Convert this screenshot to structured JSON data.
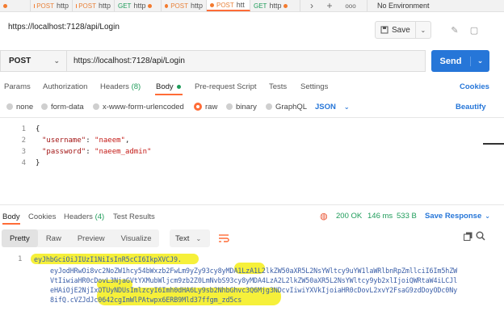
{
  "tabs": [
    {
      "method": "POST",
      "title": "http",
      "dirty": true
    },
    {
      "method": "POST",
      "title": "http",
      "dirty": true
    },
    {
      "method": "GET",
      "title": "http",
      "dirty": true
    },
    {
      "method": "POST",
      "title": "http",
      "dirty": true
    },
    {
      "method": "POST",
      "title": "htt",
      "dirty": true,
      "active": true
    },
    {
      "method": "GET",
      "title": "http",
      "dirty": true
    }
  ],
  "tabbar": {
    "new_tab": "+",
    "more": "ooo"
  },
  "environment": "No Environment",
  "request": {
    "title": "https://localhost:7128/api/Login",
    "save_label": "Save",
    "method": "POST",
    "url": "https://localhost:7128/api/Login",
    "send_label": "Send"
  },
  "request_tabs": {
    "params": "Params",
    "authorization": "Authorization",
    "headers": "Headers",
    "headers_count": "(8)",
    "body": "Body",
    "pre_request": "Pre-request Script",
    "tests": "Tests",
    "settings": "Settings",
    "cookies": "Cookies"
  },
  "body_types": {
    "none": "none",
    "form_data": "form-data",
    "urlencoded": "x-www-form-urlencoded",
    "raw": "raw",
    "binary": "binary",
    "graphql": "GraphQL",
    "json": "JSON",
    "beautify": "Beautify"
  },
  "editor": {
    "line_numbers": [
      "1",
      "2",
      "3",
      "4"
    ],
    "line1": "{",
    "line2_key": "\"username\"",
    "line2_rest": ": ",
    "line2_val": "\"naeem\"",
    "line2_end": ",",
    "line3_key": "\"password\"",
    "line3_rest": ": ",
    "line3_val": "\"naeem_admin\"",
    "line4": "}"
  },
  "response_tabs": {
    "body": "Body",
    "cookies": "Cookies",
    "headers": "Headers",
    "headers_count": "(4)",
    "test_results": "Test Results"
  },
  "status": {
    "code": "200 OK",
    "time": "146 ms",
    "size": "533 B",
    "save_response": "Save Response"
  },
  "response_toolbar": {
    "pretty": "Pretty",
    "raw": "Raw",
    "preview": "Preview",
    "visualize": "Visualize",
    "format": "Text"
  },
  "response_body": {
    "line_number": "1",
    "lines": [
      "eyJhbGciOiJIUzI1NiIsInR5cCI6IkpXVCJ9.",
      "eyJodHRwOi8vc2NoZW1hcy54bWxzb2FwLm9yZy93cy8yMDA1LzA1L2lkZW50aXR5L2NsYWltcy9uYW1laWRlbnRpZmllciI6Im5hZW",
      "VtIiwiaHR0cDovL3NjaGVtYXMubWljcm9zb2Z0LmNvbS93cy8yMDA4LzA2L2lkZW50aXR5L2NsYWltcy9yb2xlIjoiQWRtaW4iLCJl",
      "eHAiOjE2NjIxOTUyNDUsImlzcyI6Imh0dHA6Ly9sb2NhbGhvc3Q6Mjg3NDcvIiwiYXVkIjoiaHR0cDovL2xvY2FsaG9zdDoyODc0Ny",
      "8ifQ.cVZJdJc0642cgImWlPAtwpx6ERB9Mld37ffgm_zd5cs"
    ]
  },
  "colors": {
    "accent": "#ff6c37",
    "send": "#2676d8",
    "status_ok": "#1e9c5a",
    "highlight": "#f8f24a"
  }
}
